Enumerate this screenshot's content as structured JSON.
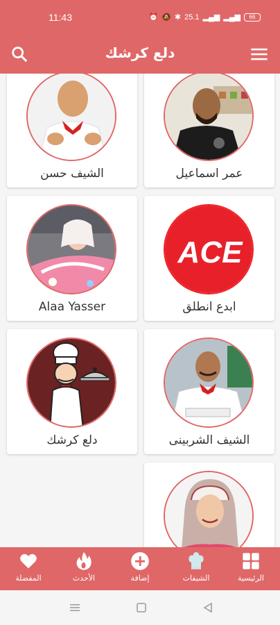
{
  "status": {
    "time": "11:43",
    "network": "25.1",
    "battery": "66"
  },
  "appbar": {
    "title": "دلع كرشك"
  },
  "chefs": [
    {
      "name": "الشيف حسن",
      "avatar": "chef-hassan"
    },
    {
      "name": "عمر اسماعيل",
      "avatar": "omar-ismail"
    },
    {
      "name": "Alaa Yasser",
      "avatar": "alaa-yasser"
    },
    {
      "name": "ابدع انطلق",
      "avatar": "ace-logo",
      "logo_text": "ACE"
    },
    {
      "name": "دلع كرشك",
      "avatar": "cartoon-chef"
    },
    {
      "name": "الشيف الشربينى",
      "avatar": "chef-sherbini"
    },
    {
      "name": "",
      "avatar": "woman-hijab"
    }
  ],
  "nav": [
    {
      "label": "الرئيسية",
      "icon": "grid-icon"
    },
    {
      "label": "الشيفات",
      "icon": "chef-hat-icon"
    },
    {
      "label": "إضافة",
      "icon": "add-icon"
    },
    {
      "label": "الأحدث",
      "icon": "fire-icon"
    },
    {
      "label": "المفضلة",
      "icon": "heart-icon"
    }
  ],
  "colors": {
    "primary": "#e06767",
    "card": "#ffffff",
    "background": "#f5f5f5"
  }
}
